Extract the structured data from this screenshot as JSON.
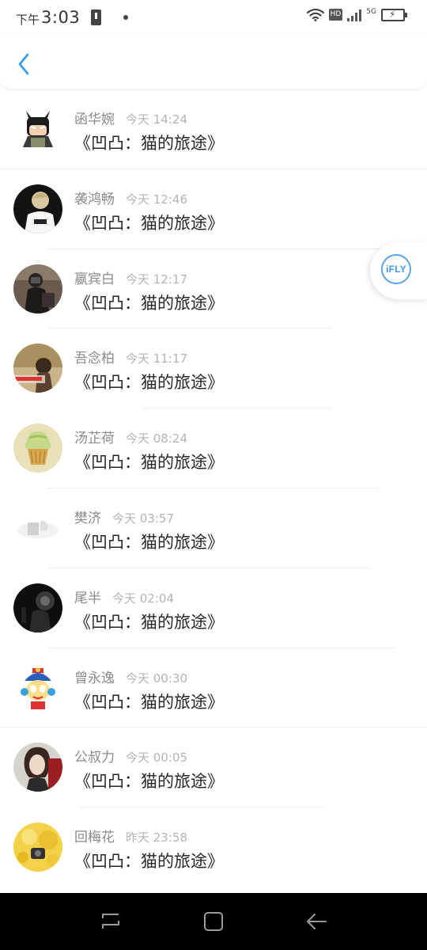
{
  "status_bar": {
    "ampm": "下午",
    "time": "3:03",
    "network_type": "5G",
    "hd_label": "HD",
    "icons": [
      "battery-warning-icon",
      "notification-dot-icon",
      "wifi-icon",
      "hd-icon",
      "signal-icon",
      "battery-charging-icon"
    ]
  },
  "header": {
    "back_icon": "chevron-left-icon",
    "accent_color": "#2f9bf0"
  },
  "floating_button": {
    "label": "iFLY",
    "color": "#4a97e3"
  },
  "list": {
    "items": [
      {
        "username": "函华婉",
        "time": "今天 14:24",
        "content": "《凹凸：猫的旅途》"
      },
      {
        "username": "袭鸿畅",
        "time": "今天 12:46",
        "content": "《凹凸：猫的旅途》"
      },
      {
        "username": "嬴宾白",
        "time": "今天 12:17",
        "content": "《凹凸：猫的旅途》"
      },
      {
        "username": "吾念柏",
        "time": "今天 11:17",
        "content": "《凹凸：猫的旅途》"
      },
      {
        "username": "汤芷荷",
        "time": "今天 08:24",
        "content": "《凹凸：猫的旅途》"
      },
      {
        "username": "樊济",
        "time": "今天 03:57",
        "content": "《凹凸：猫的旅途》"
      },
      {
        "username": "尾半",
        "time": "今天 02:04",
        "content": "《凹凸：猫的旅途》"
      },
      {
        "username": "曾永逸",
        "time": "今天 00:30",
        "content": "《凹凸：猫的旅途》"
      },
      {
        "username": "公叔力",
        "time": "今天 00:05",
        "content": "《凹凸：猫的旅途》"
      },
      {
        "username": "回梅花",
        "time": "昨天 23:58",
        "content": "《凹凸：猫的旅途》"
      }
    ]
  },
  "nav_bar": {
    "icons": [
      "recent-apps-icon",
      "home-icon",
      "back-icon"
    ]
  }
}
